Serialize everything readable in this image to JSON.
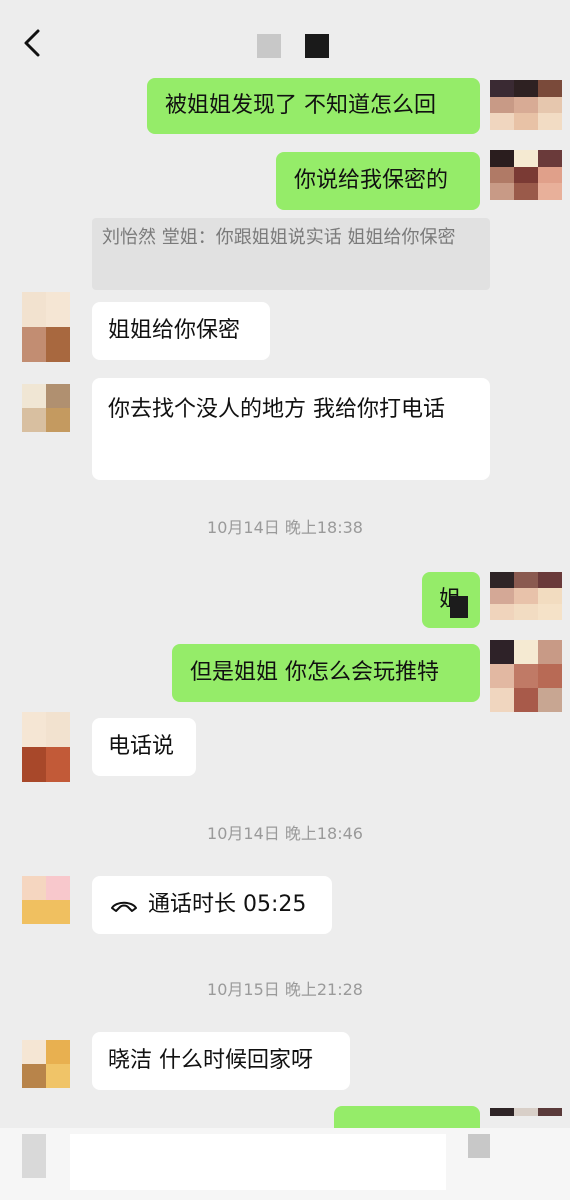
{
  "header": {
    "back_icon": "chevron-left-icon"
  },
  "messages": {
    "m1": "被姐姐发现了 不知道怎么回",
    "m2": "你说给我保密的",
    "quote": "刘怡然 堂姐：你跟姐姐说实话 姐姐给你保密",
    "m3": "姐姐给你保密",
    "m4": "你去找个没人的地方 我给你打电话",
    "m5": "姐",
    "m6": "但是姐姐 你怎么会玩推特",
    "m7": "电话说",
    "m8": "通话时长 05:25",
    "m9": "晓洁 什么时候回家呀"
  },
  "timestamps": {
    "t1": "10月14日 晚上18:38",
    "t2": "10月14日 晚上18:46",
    "t3": "10月15日 晚上21:28"
  },
  "colors": {
    "me_bubble": "#95ec69",
    "them_bubble": "#ffffff",
    "background": "#ededed"
  }
}
